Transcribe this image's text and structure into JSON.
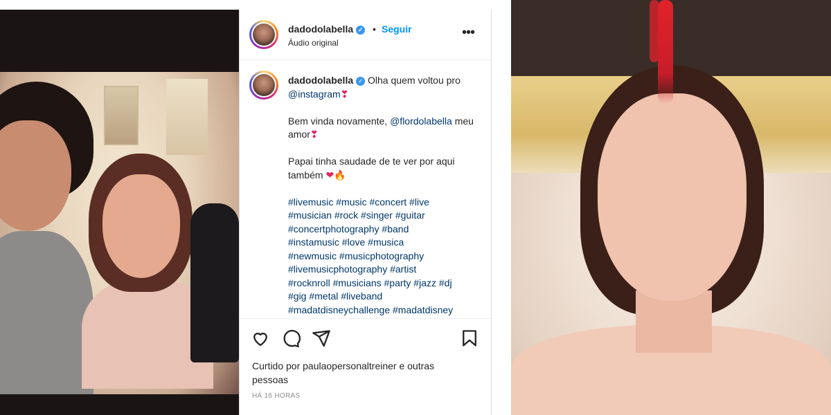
{
  "post": {
    "username": "dadodolabella",
    "follow_label": "Seguir",
    "separator": "•",
    "audio_label": "Áudio original",
    "more_label": "•••",
    "verified_mark": "✓"
  },
  "caption": {
    "username": "dadodolabella",
    "text1": "Olha quem voltou pro",
    "mention1": "@instagram",
    "text2": "Bem vinda novamente,",
    "mention2": "@flordolabella",
    "text3": "meu amor",
    "text4": "Papai tinha saudade de te ver por aqui também",
    "hashtag_lines": [
      "#livemusic #music #concert #live",
      "#musician #rock #singer #guitar",
      "#concertphotography #band",
      "#instamusic #love #musica",
      "#newmusic #musicphotography",
      "#livemusicphotography #artist",
      "#rocknroll #musicians #party #jazz #dj",
      "#gig #metal #liveband",
      "#madatdisneychallenge #madatdisney"
    ]
  },
  "emojis": {
    "heart_exclaim": "❣",
    "heart": "❤",
    "fire": "🔥"
  },
  "likes": {
    "text": "Curtido por paulaopersonaltreiner e outras pessoas"
  },
  "timestamp": "HÁ 16 HORAS",
  "icons": {
    "like": "heart-icon",
    "comment": "comment-icon",
    "share": "send-icon",
    "save": "bookmark-icon",
    "more": "more-options-icon",
    "verified": "verified-badge-icon"
  },
  "colors": {
    "link_blue": "#0095f6",
    "hashtag": "#00376b",
    "verified": "#3897f0"
  }
}
